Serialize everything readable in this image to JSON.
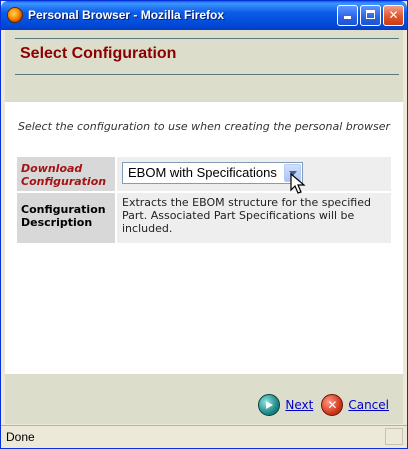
{
  "window": {
    "title": "Personal Browser - Mozilla Firefox",
    "controls": {
      "minimize": "minimize-icon",
      "maximize": "maximize-icon",
      "close": "✕"
    }
  },
  "page": {
    "title": "Select Configuration",
    "instruction": "Select the configuration to use when creating the personal browser"
  },
  "form": {
    "download_label": "Download Configuration",
    "download_value": "EBOM with Specifications",
    "description_label": "Configuration Description",
    "description_value": "Extracts the EBOM structure for the specified Part. Associated Part Specifications will be included."
  },
  "actions": {
    "next_label": "Next",
    "cancel_label": "Cancel",
    "cancel_icon_glyph": "✕"
  },
  "status": {
    "text": "Done"
  },
  "colors": {
    "title_red": "#8b0000",
    "label_red": "#a31515",
    "band": "#ddddcc",
    "link": "#0000cc"
  }
}
